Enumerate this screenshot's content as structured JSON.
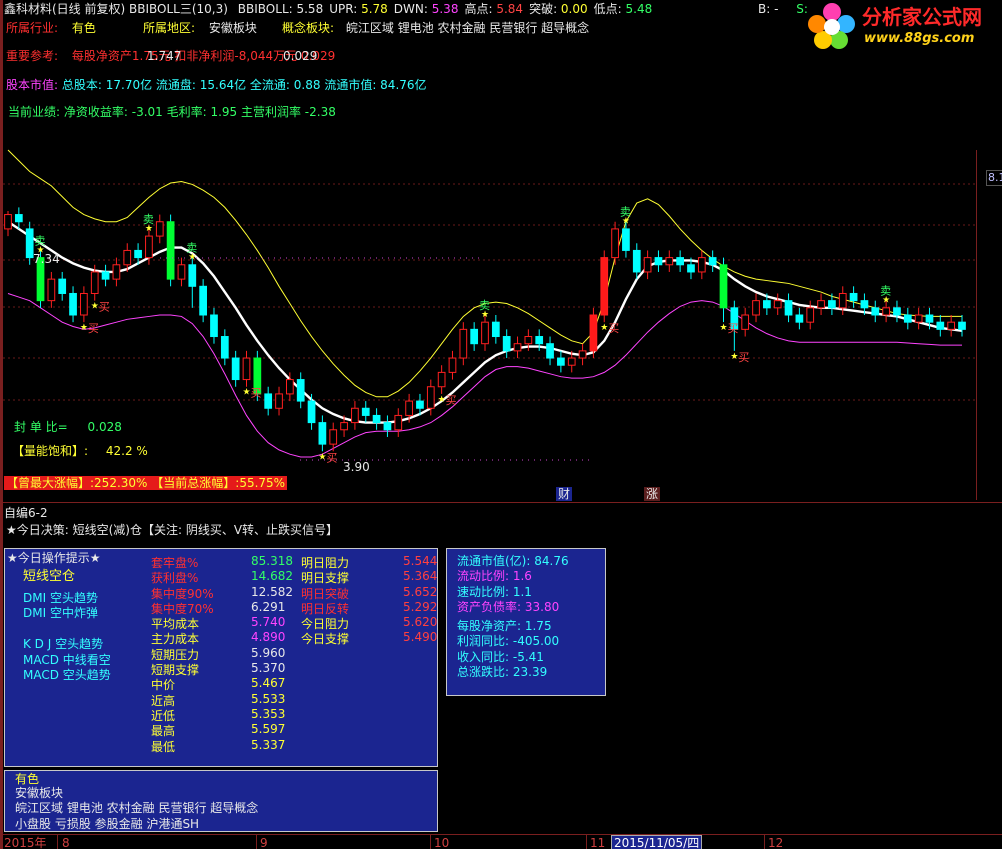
{
  "header": {
    "title": "鑫科材料(日线 前复权)",
    "indicator": "BBIBOLL三(10,3)",
    "items": [
      {
        "label": "BBIBOLL:",
        "value": "5.58",
        "color": "#e8e8e8"
      },
      {
        "label": "UPR:",
        "value": "5.78",
        "color": "#ffff33"
      },
      {
        "label": "DWN:",
        "value": "5.38",
        "color": "#ff44ff"
      },
      {
        "label": "高点:",
        "value": "5.84",
        "color": "#ff4444"
      },
      {
        "label": "突破:",
        "value": "0.00",
        "color": "#ffff33"
      },
      {
        "label": "低点:",
        "value": "5.48",
        "color": "#33ff66"
      }
    ],
    "right_labels": [
      "B:",
      "-",
      "S:"
    ],
    "right_edge": "8.1"
  },
  "logo": {
    "text": "分析家公式网",
    "url": "www.88gs.com"
  },
  "info": {
    "industry_label": "所属行业:",
    "industry": "有色",
    "region_label": "所属地区:",
    "region": "安徽板块",
    "concept_label": "概念板块:",
    "concepts": "皖江区域 锂电池 农村金融 民营银行 超导概念",
    "reference_label": "重要参考:",
    "reference_text": "每股净资产1.75元 扣非净利润-8,044万元 0.029",
    "ref_numbers": [
      "1.747",
      "0.029"
    ],
    "capital_label": "股本市值:",
    "capital": "总股本: 17.70亿 流通盘: 15.64亿 全流通: 0.88 流通市值: 84.76亿",
    "performance_label": "当前业绩:",
    "performance": "净资收益率: -3.01 毛利率: 1.95 主营利润率 -2.38"
  },
  "chart": {
    "price_labels": [
      "7.34",
      "3.90"
    ],
    "seal_label": "封 单 比=",
    "seal_value": "0.028",
    "volume_label": "【量能饱和】:",
    "volume_value": "42.2  %",
    "max_gain_label": "【曾最大涨幅】:",
    "max_gain": "252.30%",
    "current_gain_label": "【当前总涨幅】:",
    "current_gain": "55.75%",
    "markers": [
      "财",
      "涨"
    ],
    "buy_label": "买",
    "sell_label": "卖"
  },
  "chart_data": {
    "type": "candlestick",
    "ylim": [
      3.5,
      8.1
    ],
    "x_labels": [
      "2015年",
      "8",
      "9",
      "10",
      "11",
      "2015/11/05/四",
      "12"
    ],
    "series": [
      {
        "name": "BBIBOLL",
        "color": "#ffffff",
        "values": [
          7.1,
          7.0,
          6.9,
          6.8,
          6.7,
          6.6,
          6.52,
          6.46,
          6.42,
          6.4,
          6.4,
          6.44,
          6.52,
          6.6,
          6.68,
          6.74,
          6.74,
          6.66,
          6.52,
          6.34,
          6.12,
          5.9,
          5.66,
          5.44,
          5.24,
          5.06,
          4.9,
          4.76,
          4.62,
          4.5,
          4.42,
          4.36,
          4.32,
          4.3,
          4.3,
          4.3,
          4.32,
          4.36,
          4.42,
          4.5,
          4.6,
          4.72,
          4.86,
          5.0,
          5.14,
          5.24,
          5.3,
          5.34,
          5.36,
          5.36,
          5.34,
          5.3,
          5.26,
          5.24,
          5.28,
          5.44,
          5.7,
          6.02,
          6.3,
          6.48,
          6.54,
          6.56,
          6.56,
          6.56,
          6.54,
          6.5,
          6.42,
          6.3,
          6.2,
          6.12,
          6.06,
          6.02,
          5.98,
          5.94,
          5.92,
          5.9,
          5.9,
          5.88,
          5.86,
          5.84,
          5.82,
          5.8,
          5.78,
          5.74,
          5.7,
          5.66,
          5.62,
          5.6,
          5.58
        ]
      },
      {
        "name": "UPR",
        "color": "#ffff33",
        "values": [
          8.1,
          7.95,
          7.8,
          7.7,
          7.6,
          7.45,
          7.3,
          7.2,
          7.14,
          7.1,
          7.1,
          7.16,
          7.3,
          7.44,
          7.56,
          7.64,
          7.66,
          7.62,
          7.54,
          7.44,
          7.3,
          7.12,
          6.92,
          6.7,
          6.46,
          6.2,
          5.96,
          5.72,
          5.5,
          5.3,
          5.12,
          4.96,
          4.82,
          4.72,
          4.66,
          4.66,
          4.74,
          4.86,
          5.02,
          5.2,
          5.4,
          5.6,
          5.78,
          5.9,
          5.96,
          5.98,
          5.96,
          5.9,
          5.82,
          5.72,
          5.62,
          5.52,
          5.44,
          5.4,
          5.56,
          6.0,
          6.6,
          7.1,
          7.36,
          7.42,
          7.34,
          7.18,
          7.0,
          6.84,
          6.7,
          6.58,
          6.48,
          6.4,
          6.34,
          6.3,
          6.28,
          6.26,
          6.24,
          6.2,
          6.16,
          6.12,
          6.06,
          6.02,
          5.98,
          5.94,
          5.9,
          5.86,
          5.82,
          5.8,
          5.79,
          5.78,
          5.78,
          5.78,
          5.78
        ]
      },
      {
        "name": "DWN",
        "color": "#ff44ff",
        "values": [
          6.1,
          6.05,
          6.0,
          5.9,
          5.8,
          5.7,
          5.64,
          5.6,
          5.62,
          5.66,
          5.7,
          5.74,
          5.76,
          5.78,
          5.8,
          5.8,
          5.78,
          5.68,
          5.5,
          5.26,
          4.98,
          4.68,
          4.4,
          4.18,
          4.02,
          3.92,
          3.86,
          3.82,
          3.82,
          3.86,
          3.94,
          4.02,
          4.1,
          4.16,
          4.18,
          4.18,
          4.18,
          4.2,
          4.24,
          4.3,
          4.4,
          4.52,
          4.66,
          4.8,
          4.94,
          5.04,
          5.08,
          5.08,
          5.06,
          5.02,
          4.98,
          4.94,
          4.92,
          4.92,
          4.94,
          5.0,
          5.1,
          5.24,
          5.4,
          5.56,
          5.7,
          5.82,
          5.92,
          5.98,
          6.0,
          5.98,
          5.92,
          5.82,
          5.72,
          5.62,
          5.54,
          5.48,
          5.44,
          5.42,
          5.42,
          5.42,
          5.42,
          5.42,
          5.42,
          5.42,
          5.42,
          5.42,
          5.42,
          5.41,
          5.4,
          5.39,
          5.38,
          5.38,
          5.38
        ]
      }
    ],
    "candles": [
      [
        7.0,
        7.2,
        6.9,
        7.25
      ],
      [
        7.2,
        7.1,
        7.0,
        7.3
      ],
      [
        7.0,
        6.6,
        6.5,
        7.1
      ],
      [
        6.6,
        6.0,
        5.9,
        6.7
      ],
      [
        6.0,
        6.3,
        5.9,
        6.4
      ],
      [
        6.3,
        6.1,
        6.0,
        6.4
      ],
      [
        6.1,
        5.8,
        5.7,
        6.2
      ],
      [
        5.8,
        6.1,
        5.7,
        6.2
      ],
      [
        6.1,
        6.4,
        6.0,
        6.5
      ],
      [
        6.4,
        6.3,
        6.2,
        6.5
      ],
      [
        6.3,
        6.5,
        6.2,
        6.6
      ],
      [
        6.5,
        6.7,
        6.4,
        6.8
      ],
      [
        6.7,
        6.6,
        6.5,
        6.8
      ],
      [
        6.6,
        6.9,
        6.5,
        7.0
      ],
      [
        6.9,
        7.1,
        6.8,
        7.2
      ],
      [
        7.1,
        6.3,
        6.2,
        7.2
      ],
      [
        6.3,
        6.5,
        6.2,
        6.6
      ],
      [
        6.5,
        6.2,
        5.9,
        6.6
      ],
      [
        6.2,
        5.8,
        5.7,
        6.3
      ],
      [
        5.8,
        5.5,
        5.4,
        5.9
      ],
      [
        5.5,
        5.2,
        5.1,
        5.6
      ],
      [
        5.2,
        4.9,
        4.8,
        5.3
      ],
      [
        4.9,
        5.2,
        4.8,
        5.3
      ],
      [
        5.2,
        4.7,
        4.6,
        5.3
      ],
      [
        4.7,
        4.5,
        4.4,
        4.8
      ],
      [
        4.5,
        4.7,
        4.4,
        4.8
      ],
      [
        4.7,
        4.9,
        4.6,
        5.0
      ],
      [
        4.9,
        4.6,
        4.5,
        5.0
      ],
      [
        4.6,
        4.3,
        4.2,
        4.7
      ],
      [
        4.3,
        4.0,
        3.9,
        4.4
      ],
      [
        4.0,
        4.2,
        3.9,
        4.3
      ],
      [
        4.2,
        4.3,
        4.1,
        4.4
      ],
      [
        4.3,
        4.5,
        4.2,
        4.6
      ],
      [
        4.5,
        4.4,
        4.3,
        4.6
      ],
      [
        4.4,
        4.3,
        4.2,
        4.5
      ],
      [
        4.3,
        4.2,
        4.1,
        4.4
      ],
      [
        4.2,
        4.4,
        4.1,
        4.5
      ],
      [
        4.4,
        4.6,
        4.3,
        4.7
      ],
      [
        4.6,
        4.5,
        4.4,
        4.7
      ],
      [
        4.5,
        4.8,
        4.4,
        4.9
      ],
      [
        4.8,
        5.0,
        4.7,
        5.1
      ],
      [
        5.0,
        5.2,
        4.9,
        5.3
      ],
      [
        5.2,
        5.6,
        5.1,
        5.7
      ],
      [
        5.6,
        5.4,
        5.3,
        5.7
      ],
      [
        5.4,
        5.7,
        5.3,
        5.8
      ],
      [
        5.7,
        5.5,
        5.4,
        5.8
      ],
      [
        5.5,
        5.3,
        5.2,
        5.6
      ],
      [
        5.3,
        5.4,
        5.2,
        5.5
      ],
      [
        5.4,
        5.5,
        5.3,
        5.6
      ],
      [
        5.5,
        5.4,
        5.3,
        5.6
      ],
      [
        5.4,
        5.2,
        5.1,
        5.5
      ],
      [
        5.2,
        5.1,
        5.0,
        5.3
      ],
      [
        5.1,
        5.2,
        5.0,
        5.3
      ],
      [
        5.2,
        5.3,
        5.1,
        5.4
      ],
      [
        5.3,
        5.8,
        5.2,
        5.9
      ],
      [
        5.8,
        6.6,
        5.7,
        6.7
      ],
      [
        6.6,
        7.0,
        6.5,
        7.1
      ],
      [
        7.0,
        6.7,
        6.6,
        7.1
      ],
      [
        6.7,
        6.4,
        6.3,
        6.8
      ],
      [
        6.4,
        6.6,
        6.3,
        6.7
      ],
      [
        6.6,
        6.5,
        6.4,
        6.7
      ],
      [
        6.5,
        6.6,
        6.4,
        6.7
      ],
      [
        6.6,
        6.5,
        6.4,
        6.7
      ],
      [
        6.5,
        6.4,
        6.3,
        6.6
      ],
      [
        6.4,
        6.6,
        6.3,
        6.7
      ],
      [
        6.6,
        6.5,
        6.4,
        6.7
      ],
      [
        6.5,
        5.9,
        5.7,
        6.6
      ],
      [
        5.9,
        5.6,
        5.3,
        6.0
      ],
      [
        5.6,
        5.8,
        5.5,
        5.9
      ],
      [
        5.8,
        6.0,
        5.7,
        6.1
      ],
      [
        6.0,
        5.9,
        5.8,
        6.1
      ],
      [
        5.9,
        6.0,
        5.8,
        6.1
      ],
      [
        6.0,
        5.8,
        5.7,
        6.1
      ],
      [
        5.8,
        5.7,
        5.6,
        5.9
      ],
      [
        5.7,
        5.9,
        5.6,
        6.0
      ],
      [
        5.9,
        6.0,
        5.8,
        6.1
      ],
      [
        6.0,
        5.9,
        5.8,
        6.1
      ],
      [
        5.9,
        6.1,
        5.8,
        6.2
      ],
      [
        6.1,
        6.0,
        5.9,
        6.2
      ],
      [
        6.0,
        5.9,
        5.8,
        6.1
      ],
      [
        5.9,
        5.8,
        5.7,
        6.0
      ],
      [
        5.8,
        5.9,
        5.7,
        6.0
      ],
      [
        5.9,
        5.8,
        5.7,
        6.0
      ],
      [
        5.8,
        5.7,
        5.6,
        5.9
      ],
      [
        5.7,
        5.8,
        5.6,
        5.9
      ],
      [
        5.8,
        5.7,
        5.6,
        5.9
      ],
      [
        5.7,
        5.6,
        5.5,
        5.8
      ],
      [
        5.6,
        5.7,
        5.5,
        5.8
      ],
      [
        5.7,
        5.6,
        5.5,
        5.8
      ]
    ],
    "candle_format": "open,close,low,high"
  },
  "decision": {
    "title": "自编6-2",
    "text": "★今日决策: 短线空(减)仓【关注: 阴线买、V转、止跌买信号】"
  },
  "ops_panel": {
    "title": "★今日操作提示★",
    "signals": [
      "短线空仓",
      "DMI 空头趋势",
      "DMI 空中炸弹",
      "",
      "K D J 空头趋势",
      "MACD 中线看空",
      "MACD 空头趋势"
    ],
    "metrics": [
      {
        "label": "套牢盘%",
        "value": "85.318",
        "lc": "#ff3030",
        "vc": "#33ff66"
      },
      {
        "label": "获利盘%",
        "value": "14.682",
        "lc": "#ff3030",
        "vc": "#33ff66"
      },
      {
        "label": "集中度90%",
        "value": "12.582",
        "lc": "#ff3030",
        "vc": "#e8e8e8"
      },
      {
        "label": "集中度70%",
        "value": "6.291",
        "lc": "#ff3030",
        "vc": "#e8e8e8"
      },
      {
        "label": "平均成本",
        "value": "5.740",
        "lc": "#ffff33",
        "vc": "#ff44ff"
      },
      {
        "label": "主力成本",
        "value": "4.890",
        "lc": "#ffff33",
        "vc": "#ff44ff"
      },
      {
        "label": "短期压力",
        "value": "5.960",
        "lc": "#ffff33",
        "vc": "#e8e8e8"
      },
      {
        "label": "短期支撑",
        "value": "5.370",
        "lc": "#ffff33",
        "vc": "#e8e8e8"
      },
      {
        "label": "中价",
        "value": "5.467",
        "lc": "#ffff33",
        "vc": "#ffff33"
      },
      {
        "label": "近高",
        "value": "5.533",
        "lc": "#ffff33",
        "vc": "#ffff33"
      },
      {
        "label": "近低",
        "value": "5.353",
        "lc": "#ffff33",
        "vc": "#ffff33"
      },
      {
        "label": "最高",
        "value": "5.597",
        "lc": "#ffff33",
        "vc": "#ffff33"
      },
      {
        "label": "最低",
        "value": "5.337",
        "lc": "#ffff33",
        "vc": "#ffff33"
      }
    ],
    "targets": [
      {
        "label": "明日阻力",
        "value": "5.544",
        "lc": "#ffff33"
      },
      {
        "label": "明日支撑",
        "value": "5.364",
        "lc": "#ffff33"
      },
      {
        "label": "明日突破",
        "value": "5.652",
        "lc": "#ff3030"
      },
      {
        "label": "明日反转",
        "value": "5.292",
        "lc": "#ff3030"
      },
      {
        "label": "今日阻力",
        "value": "5.620",
        "lc": "#ffff33"
      },
      {
        "label": "今日支撑",
        "value": "5.490",
        "lc": "#ffff33"
      }
    ]
  },
  "fin_panel": {
    "rows": [
      {
        "label": "流通市值(亿):",
        "value": "84.76",
        "color": "#33ffff"
      },
      {
        "label": "流动比例:",
        "value": "1.6",
        "color": "#ff44ff"
      },
      {
        "label": "速动比例:",
        "value": "1.1",
        "color": "#33ffff"
      },
      {
        "label": "资产负债率:",
        "value": "33.80",
        "color": "#ff44ff"
      },
      {
        "label": "每股净资产:",
        "value": "1.75",
        "color": "#33ffff"
      },
      {
        "label": "利润同比:",
        "value": "-405.00",
        "color": "#33ffff"
      },
      {
        "label": "收入同比:",
        "value": "-5.41",
        "color": "#33ffff"
      },
      {
        "label": "总涨跌比:",
        "value": "23.39",
        "color": "#33ffff"
      }
    ]
  },
  "bottom_panel": {
    "lines": [
      "有色",
      "安徽板块",
      "皖江区域 锂电池 农村金融 民营银行 超导概念",
      "小盘股 亏损股 参股金融 沪港通SH"
    ]
  },
  "colors": {
    "bg": "#000000",
    "up": "#ff2020",
    "down": "#00ffff",
    "panel": "#1b2590"
  }
}
